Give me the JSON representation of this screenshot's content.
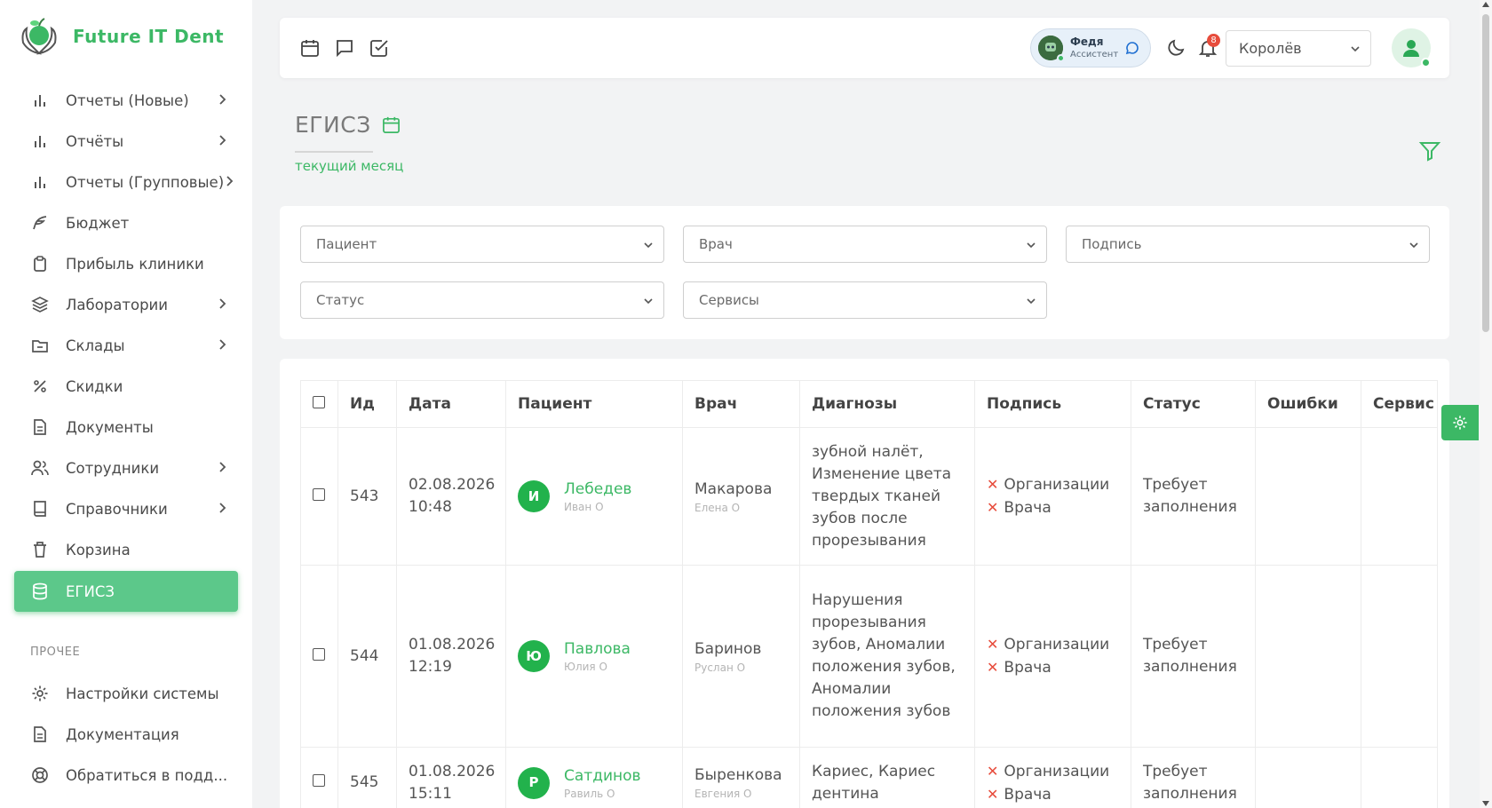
{
  "brand": {
    "name": "Future IT Dent"
  },
  "sidebar": {
    "items": [
      {
        "label": "Отчеты (Новые)",
        "icon": "bar-chart-icon",
        "has_children": true
      },
      {
        "label": "Отчёты",
        "icon": "bar-chart-icon",
        "has_children": true
      },
      {
        "label": "Отчеты (Групповые)",
        "icon": "bar-chart-icon",
        "has_children": true
      },
      {
        "label": "Бюджет",
        "icon": "feather-icon",
        "has_children": false
      },
      {
        "label": "Прибыль клиники",
        "icon": "clipboard-icon",
        "has_children": false
      },
      {
        "label": "Лаборатории",
        "icon": "layers-icon",
        "has_children": true
      },
      {
        "label": "Склады",
        "icon": "folder-icon",
        "has_children": true
      },
      {
        "label": "Скидки",
        "icon": "percent-icon",
        "has_children": false
      },
      {
        "label": "Документы",
        "icon": "document-icon",
        "has_children": false
      },
      {
        "label": "Сотрудники",
        "icon": "users-icon",
        "has_children": true
      },
      {
        "label": "Справочники",
        "icon": "book-icon",
        "has_children": true
      },
      {
        "label": "Корзина",
        "icon": "trash-icon",
        "has_children": false
      },
      {
        "label": "ЕГИСЗ",
        "icon": "database-icon",
        "has_children": false,
        "active": true
      }
    ],
    "other_section_label": "ПРОЧЕЕ",
    "other_items": [
      {
        "label": "Настройки системы",
        "icon": "gear-icon"
      },
      {
        "label": "Документация",
        "icon": "document-icon"
      },
      {
        "label": "Обратиться в подд...",
        "icon": "lifebuoy-icon"
      }
    ]
  },
  "topbar": {
    "icons": [
      "calendar-icon",
      "chat-icon",
      "checkbox-icon"
    ],
    "assistant": {
      "name": "Федя",
      "role": "Ассистент"
    },
    "notifications_count": "8",
    "branch": "Королёв"
  },
  "page": {
    "title": "ЕГИСЗ",
    "period": "текущий месяц"
  },
  "filters": {
    "patient": "Пациент",
    "doctor": "Врач",
    "signature": "Подпись",
    "status": "Статус",
    "services": "Сервисы"
  },
  "table": {
    "headers": [
      "Ид",
      "Дата",
      "Пациент",
      "Врач",
      "Диагнозы",
      "Подпись",
      "Статус",
      "Ошибки",
      "Сервис"
    ],
    "rows": [
      {
        "id": "543",
        "date": "02.08.2026",
        "time": "10:48",
        "patient_initial": "И",
        "patient_last": "Лебедев",
        "patient_first": "Иван О",
        "doctor_last": "Макарова",
        "doctor_first": "Елена О",
        "diagnoses": "зубной налёт, Изменение цвета твердых тканей зубов после прорезывания",
        "sign_org": "Организации",
        "sign_doc": "Врача",
        "status": "Требует заполнения"
      },
      {
        "id": "544",
        "date": "01.08.2026",
        "time": "12:19",
        "patient_initial": "Ю",
        "patient_last": "Павлова",
        "patient_first": "Юлия О",
        "doctor_last": "Баринов",
        "doctor_first": "Руслан О",
        "diagnoses": "Нарушения прорезывания зубов, Аномалии положения зубов, Аномалии положения зубов",
        "sign_org": "Организации",
        "sign_doc": "Врача",
        "status": "Требует заполнения"
      },
      {
        "id": "545",
        "date": "01.08.2026",
        "time": "15:11",
        "patient_initial": "Р",
        "patient_last": "Сатдинов",
        "patient_first": "Равиль О",
        "doctor_last": "Быренкова",
        "doctor_first": "Евгения О",
        "diagnoses": "Кариес, Кариес дентина",
        "sign_org": "Организации",
        "sign_doc": "Врача",
        "status": "Требует заполнения"
      }
    ]
  },
  "colors": {
    "accent": "#3cb865",
    "danger": "#e74c3c"
  }
}
